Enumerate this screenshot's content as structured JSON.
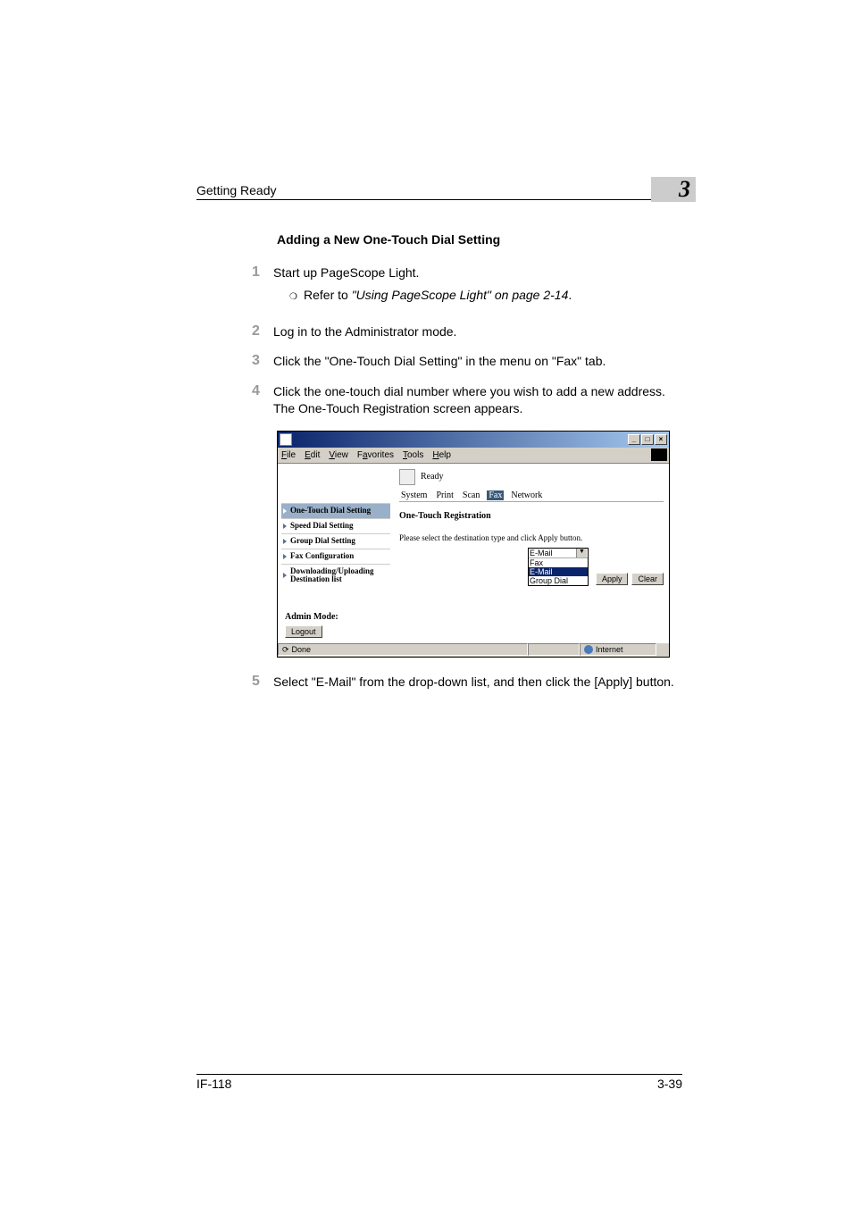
{
  "header": {
    "running_head": "Getting Ready",
    "chapter_number": "3"
  },
  "section_title": "Adding a New One-Touch Dial Setting",
  "steps": [
    {
      "num": "1",
      "text": "Start up PageScope Light.",
      "sub": {
        "prefix": "Refer to ",
        "italic": "\"Using PageScope Light\" on page 2-14",
        "suffix": "."
      }
    },
    {
      "num": "2",
      "text": "Log in to the Administrator mode."
    },
    {
      "num": "3",
      "text": "Click the \"One-Touch Dial Setting\" in the menu on \"Fax\" tab."
    },
    {
      "num": "4",
      "text": "Click the one-touch dial number where you wish to add a new address. The One-Touch Registration screen appears."
    },
    {
      "num": "5",
      "text": "Select \"E-Mail\" from the drop-down list, and then click the [Apply] button."
    }
  ],
  "screenshot": {
    "menubar": [
      "File",
      "Edit",
      "View",
      "Favorites",
      "Tools",
      "Help"
    ],
    "sidebar_items": [
      {
        "label": "One-Touch Dial Setting",
        "active": true
      },
      {
        "label": "Speed Dial Setting",
        "active": false
      },
      {
        "label": "Group Dial Setting",
        "active": false
      },
      {
        "label": "Fax Configuration",
        "active": false
      },
      {
        "label": "Downloading/Uploading Destination list",
        "active": false
      }
    ],
    "admin_mode_label": "Admin Mode:",
    "logout_label": "Logout",
    "status_text": "Ready",
    "tabs": [
      "System",
      "Print",
      "Scan",
      "Fax",
      "Network"
    ],
    "active_tab": "Fax",
    "content_title": "One-Touch Registration",
    "content_instruction": "Please select the destination type and click Apply button.",
    "select_options": [
      "E-Mail",
      "Fax",
      "E-Mail",
      "Group Dial"
    ],
    "buttons": {
      "apply": "Apply",
      "clear": "Clear"
    },
    "statusbar": {
      "done": "Done",
      "internet": "Internet"
    }
  },
  "footer": {
    "product": "IF-118",
    "page_number": "3-39"
  }
}
